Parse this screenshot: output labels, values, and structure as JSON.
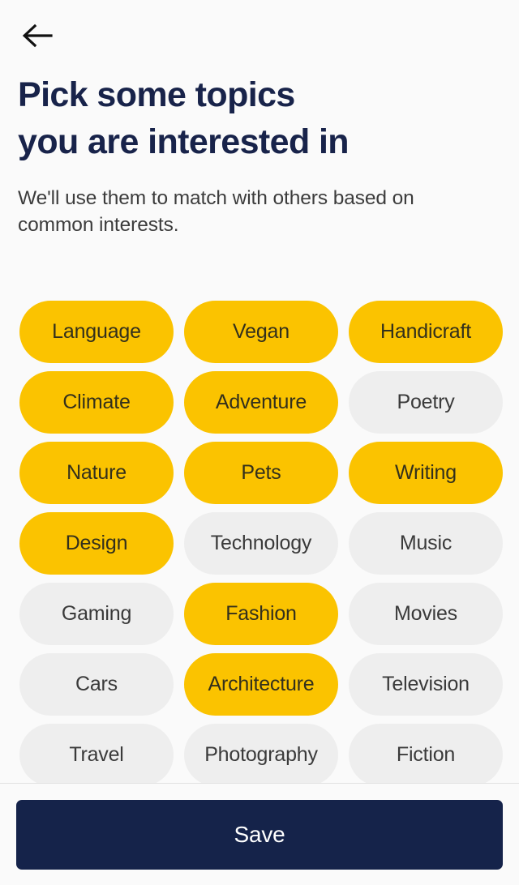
{
  "topbar": {
    "back_icon": "arrow-left-icon"
  },
  "header": {
    "title": "Pick some topics\nyou are interested in",
    "subtitle": "We'll use them to match with others based on\ncommon interests."
  },
  "colors": {
    "background": "#fafafa",
    "title": "#18234a",
    "subtitle": "#3c3c3c",
    "chip_selected_bg": "#fbc300",
    "chip_selected_text": "#33301c",
    "chip_unselected_bg": "#eeeeee",
    "chip_unselected_text": "#3a3a3a",
    "save_button_bg": "#15234a",
    "save_button_text": "#ffffff",
    "divider": "#e2e2e2"
  },
  "topics": [
    {
      "label": "Language",
      "selected": true
    },
    {
      "label": "Vegan",
      "selected": true
    },
    {
      "label": "Handicraft",
      "selected": true
    },
    {
      "label": "Climate",
      "selected": true
    },
    {
      "label": "Adventure",
      "selected": true
    },
    {
      "label": "Poetry",
      "selected": false
    },
    {
      "label": "Nature",
      "selected": true
    },
    {
      "label": "Pets",
      "selected": true
    },
    {
      "label": "Writing",
      "selected": true
    },
    {
      "label": "Design",
      "selected": true
    },
    {
      "label": "Technology",
      "selected": false
    },
    {
      "label": "Music",
      "selected": false
    },
    {
      "label": "Gaming",
      "selected": false
    },
    {
      "label": "Fashion",
      "selected": true
    },
    {
      "label": "Movies",
      "selected": false
    },
    {
      "label": "Cars",
      "selected": false
    },
    {
      "label": "Architecture",
      "selected": true
    },
    {
      "label": "Television",
      "selected": false
    },
    {
      "label": "Travel",
      "selected": false
    },
    {
      "label": "Photography",
      "selected": false
    },
    {
      "label": "Fiction",
      "selected": false
    }
  ],
  "bottom_bar": {
    "save_label": "Save"
  }
}
